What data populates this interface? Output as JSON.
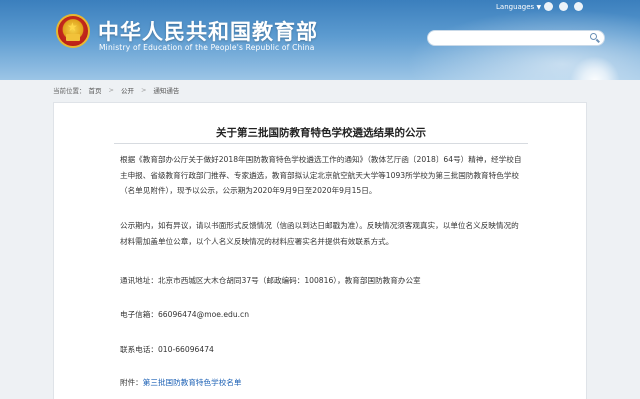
{
  "header": {
    "title": "中华人民共和国教育部",
    "subtitle": "Ministry of Education of the People's Republic of China",
    "languages_label": "Languages",
    "languages_arrow": "▼"
  },
  "search": {
    "value": "",
    "placeholder": ""
  },
  "breadcrumb": {
    "label": "当前位置：",
    "items": [
      "首页",
      "公开",
      "通知通告"
    ]
  },
  "article": {
    "title": "关于第三批国防教育特色学校遴选结果的公示",
    "paragraph1": "根据《教育部办公厅关于做好2018年国防教育特色学校遴选工作的通知》（教体艺厅函〔2018〕64号）精神，经学校自主申报、省级教育行政部门推荐、专家遴选，教育部拟认定北京航空航天大学等1093所学校为第三批国防教育特色学校（名单见附件），现予以公示，公示期为2020年9月9日至2020年9月15日。",
    "paragraph2": "公示期内，如有异议，请以书面形式反馈情况（信函以到达日邮戳为准）。反映情况须客观真实，以单位名义反映情况的材料需加盖单位公章，以个人名义反映情况的材料应署实名并提供有效联系方式。",
    "address": "通讯地址：北京市西城区大木仓胡同37号（邮政编码：100816），教育部国防教育办公室",
    "email": "电子信箱：66096474@moe.edu.cn",
    "phone": "联系电话：010-66096474",
    "attachment_label": "附件：",
    "attachment_link": "第三批国防教育特色学校名单"
  },
  "colors": {
    "header_blue": "#3b7fbd",
    "link_blue": "#1a5fb4",
    "emblem_red": "#b2140e",
    "emblem_gold": "#e8b830"
  },
  "icons": {
    "emblem": "national-emblem-icon",
    "search": "search-icon",
    "top_icons": [
      "home-icon",
      "share-icon",
      "mobile-icon"
    ]
  }
}
